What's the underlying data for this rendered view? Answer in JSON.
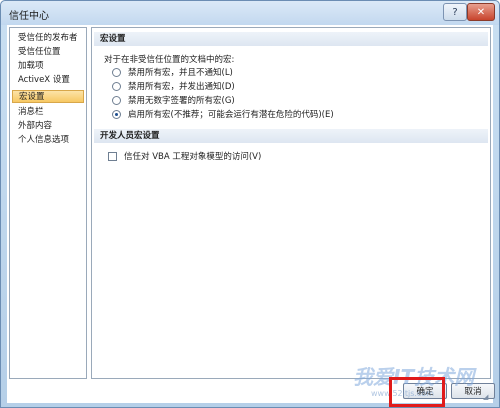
{
  "window": {
    "title": "信任中心",
    "help_icon": "question-icon",
    "close_icon": "close-icon",
    "help_label": "?",
    "close_label": "✕"
  },
  "sidebar": {
    "items": [
      {
        "label": "受信任的发布者",
        "active": false
      },
      {
        "label": "受信任位置",
        "active": false
      },
      {
        "label": "加载项",
        "active": false
      },
      {
        "label": "ActiveX 设置",
        "active": false
      },
      {
        "label": "宏设置",
        "active": true
      },
      {
        "label": "消息栏",
        "active": false
      },
      {
        "label": "外部内容",
        "active": false
      },
      {
        "label": "个人信息选项",
        "active": false
      }
    ]
  },
  "macro_settings": {
    "header": "宏设置",
    "intro": "对于在非受信任位置的文档中的宏:",
    "options": [
      {
        "label": "禁用所有宏，并且不通知(L)",
        "checked": false
      },
      {
        "label": "禁用所有宏，并发出通知(D)",
        "checked": false
      },
      {
        "label": "禁用无数字签署的所有宏(G)",
        "checked": false
      },
      {
        "label": "启用所有宏(不推荐；可能会运行有潜在危险的代码)(E)",
        "checked": true
      }
    ]
  },
  "developer_macro_settings": {
    "header": "开发人员宏设置",
    "vba_trust_label": "信任对 VBA 工程对象模型的访问(V)",
    "vba_trust_checked": false
  },
  "buttons": {
    "ok_label": "确定",
    "cancel_label": "取消"
  },
  "watermark": {
    "text": "我爱IT技术网",
    "url": "www.52itjs.com"
  },
  "colors": {
    "highlight": "#e01b1b",
    "active_item": "#f7c863",
    "title_bar": "#c2d8ef"
  }
}
